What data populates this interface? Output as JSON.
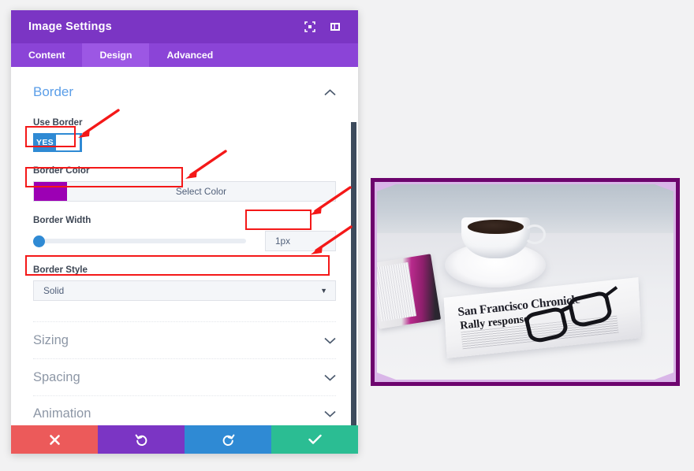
{
  "panel": {
    "title": "Image Settings",
    "header_icons": [
      {
        "name": "focus-icon"
      },
      {
        "name": "layout-panel-icon"
      }
    ],
    "tabs": [
      {
        "label": "Content",
        "active": false
      },
      {
        "label": "Design",
        "active": true
      },
      {
        "label": "Advanced",
        "active": false
      }
    ],
    "sections": {
      "border": {
        "title": "Border",
        "expanded": true,
        "chevron": "chevron-up-icon",
        "fields": {
          "use_border": {
            "label": "Use Border",
            "toggle_value": "YES"
          },
          "border_color": {
            "label": "Border Color",
            "button_label": "Select Color",
            "swatch_hex": "#9c00b4"
          },
          "border_width": {
            "label": "Border Width",
            "input_value": "1px",
            "slider_position_percent": 0
          },
          "border_style": {
            "label": "Border Style",
            "selected": "Solid",
            "caret": "▼"
          }
        }
      }
    },
    "collapsed_sections": [
      {
        "label": "Sizing",
        "chevron": "chevron-down-icon"
      },
      {
        "label": "Spacing",
        "chevron": "chevron-down-icon"
      },
      {
        "label": "Animation",
        "chevron": "chevron-down-icon"
      }
    ],
    "footer_buttons": [
      {
        "name": "cancel-button",
        "icon": "close-icon",
        "color": "#ec5a5a"
      },
      {
        "name": "undo-button",
        "icon": "undo-icon",
        "color": "#7b35c4"
      },
      {
        "name": "redo-button",
        "icon": "redo-icon",
        "color": "#2f8ad4"
      },
      {
        "name": "save-button",
        "icon": "check-icon",
        "color": "#2bbd93"
      }
    ],
    "accent_hex": "#7b35c4",
    "tabs_bar_hex": "#8b44d7",
    "section_title_hex": "#5b9ee8"
  },
  "preview": {
    "border_color_hex": "#6d046d",
    "inner_frame_hex": "#d9b6e8",
    "newspaper_masthead": "San Francisco Chronicle",
    "newspaper_headline": "Rally response"
  },
  "annotations": {
    "color_hex": "#f41818",
    "boxes": [
      {
        "name": "use-border-highlight"
      },
      {
        "name": "border-color-highlight"
      },
      {
        "name": "border-width-highlight"
      },
      {
        "name": "border-style-highlight"
      }
    ],
    "arrows": [
      {
        "name": "arrow-to-use-border"
      },
      {
        "name": "arrow-to-border-color"
      },
      {
        "name": "arrow-to-border-width"
      },
      {
        "name": "arrow-to-border-style"
      }
    ]
  }
}
